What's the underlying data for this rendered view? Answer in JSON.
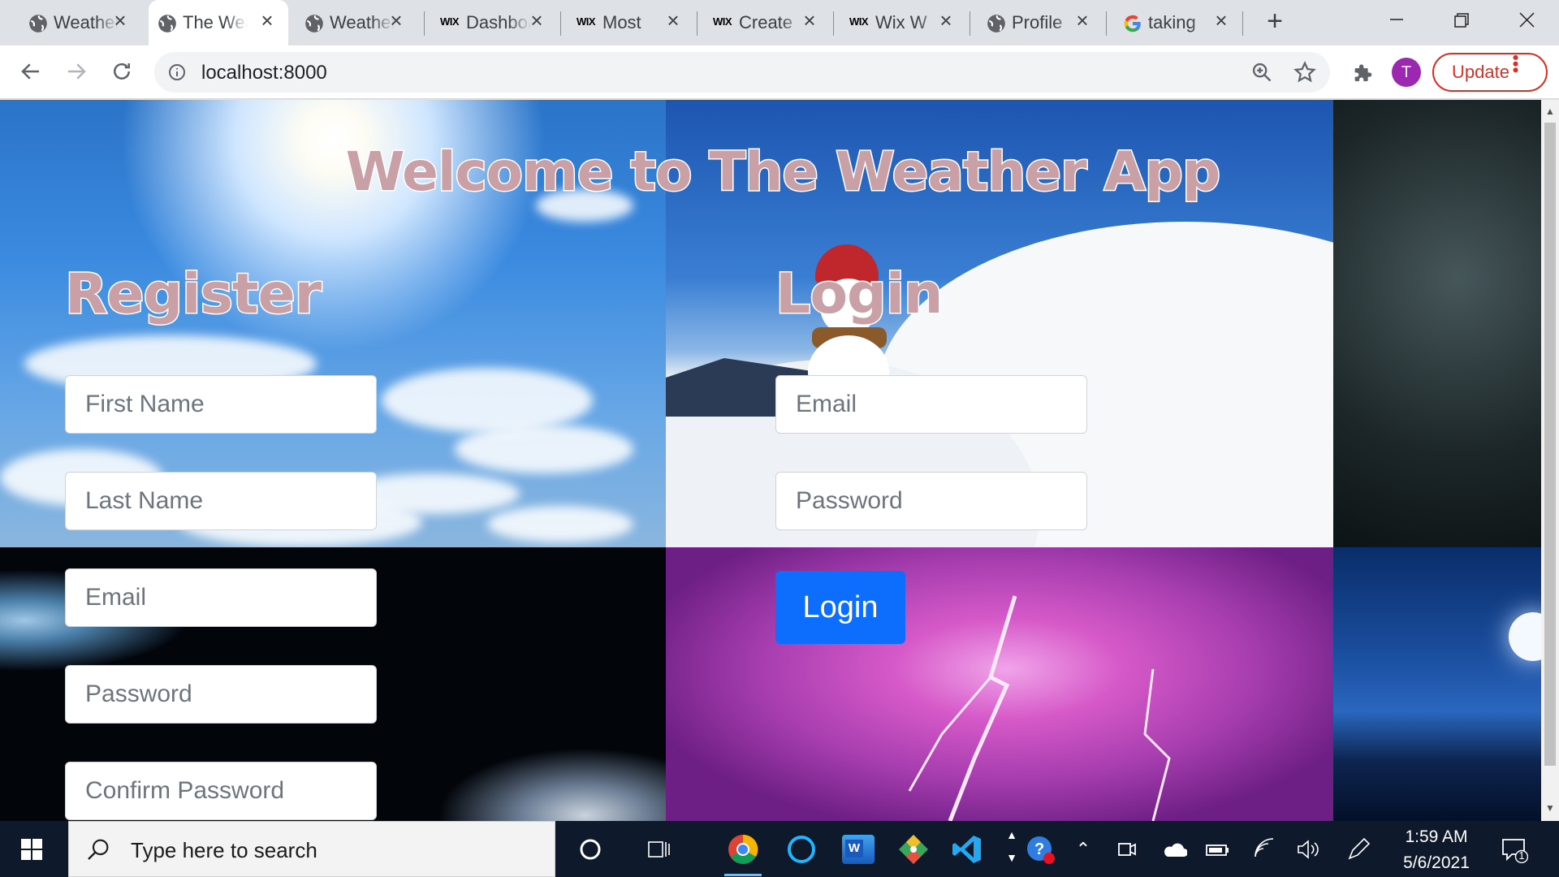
{
  "browser": {
    "tabs": [
      {
        "title": "Weather",
        "favicon": "globe-icon",
        "active": false
      },
      {
        "title": "The Weather App",
        "favicon": "globe-icon",
        "active": true
      },
      {
        "title": "Weather",
        "favicon": "globe-icon",
        "active": false
      },
      {
        "title": "Dashboard",
        "favicon": "wix-icon",
        "active": false
      },
      {
        "title": "Most",
        "favicon": "wix-icon",
        "active": false
      },
      {
        "title": "Create",
        "favicon": "wix-icon",
        "active": false
      },
      {
        "title": "Wix W",
        "favicon": "wix-icon",
        "active": false
      },
      {
        "title": "Profile",
        "favicon": "globe-icon",
        "active": false
      },
      {
        "title": "taking",
        "favicon": "google-icon",
        "active": false
      }
    ],
    "favicon_wix_text": "WIX",
    "address": "localhost:8000",
    "profile_initial": "T",
    "update_label": "Update",
    "colors": {
      "profile": "#9c27b0",
      "update": "#d93025"
    }
  },
  "page": {
    "title": "Welcome to The Weather App",
    "register": {
      "heading": "Register",
      "fields": {
        "first_name": "First Name",
        "last_name": "Last Name",
        "email": "Email",
        "password": "Password",
        "confirm_password": "Confirm Password"
      }
    },
    "login": {
      "heading": "Login",
      "fields": {
        "email": "Email",
        "password": "Password"
      },
      "button_label": "Login"
    },
    "colors": {
      "title_fill": "#c8a0a6",
      "button": "#0d6efd"
    }
  },
  "taskbar": {
    "search_placeholder": "Type here to search",
    "time": "1:59 AM",
    "date": "5/6/2021",
    "notification_count": "1",
    "word_letter": "W",
    "pinned": [
      "chrome-icon",
      "cortana-icon",
      "word-icon",
      "git-icon",
      "vscode-icon"
    ]
  }
}
